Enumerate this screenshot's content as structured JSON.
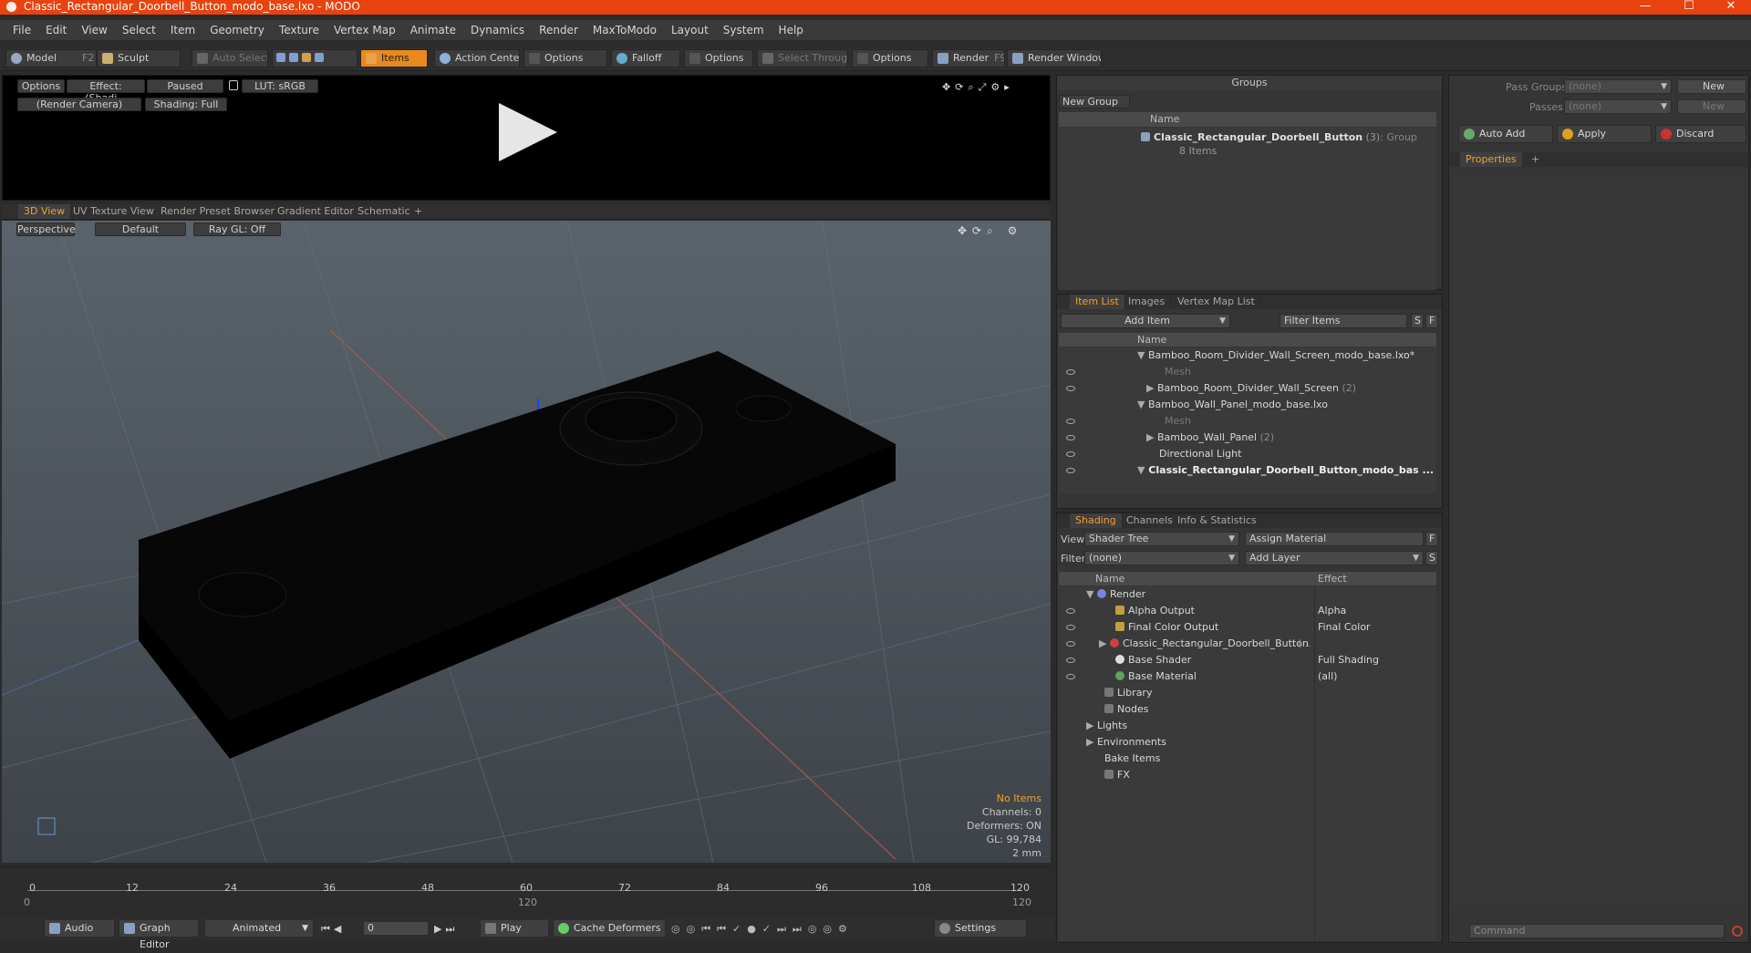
{
  "window": {
    "title": "Classic_Rectangular_Doorbell_Button_modo_base.lxo - MODO",
    "minimize": "—",
    "maximize": "☐",
    "close": "✕"
  },
  "menu": [
    "File",
    "Edit",
    "View",
    "Select",
    "Item",
    "Geometry",
    "Texture",
    "Vertex Map",
    "Animate",
    "Dynamics",
    "Render",
    "MaxToModo",
    "Layout",
    "System",
    "Help"
  ],
  "toolbar": {
    "model": "Model",
    "model_key": "F2",
    "sculpt": "Sculpt",
    "auto_select": "Auto Select",
    "items": "Items",
    "action_center": "Action Center",
    "options1": "Options",
    "falloff": "Falloff",
    "options2": "Options",
    "select_through": "Select Through",
    "options3": "Options",
    "render": "Render",
    "render_key": "F9",
    "render_window": "Render Window"
  },
  "preview": {
    "options": "Options",
    "effect": "Effect: (Shadi...",
    "paused": "Paused",
    "lut": "LUT: sRGB",
    "camera": "(Render Camera)",
    "shading": "Shading: Full"
  },
  "view_tabs": [
    "3D View",
    "UV Texture View",
    "Render Preset Browser",
    "Gradient Editor",
    "Schematic"
  ],
  "viewport": {
    "perspective": "Perspective",
    "default": "Default",
    "raygl": "Ray GL: Off"
  },
  "stats": {
    "no_items": "No Items",
    "channels": "Channels: 0",
    "deformers": "Deformers: ON",
    "gl": "GL: 99,784",
    "unit": "2 mm"
  },
  "timeline": {
    "ticks": [
      "0",
      "12",
      "24",
      "36",
      "48",
      "60",
      "72",
      "84",
      "96",
      "108",
      "120"
    ],
    "lower_start": "0",
    "lower_mid": "120",
    "lower_end": "120"
  },
  "bottom": {
    "audio": "Audio",
    "graph_editor": "Graph Editor",
    "animated": "Animated",
    "frame": "0",
    "play": "Play",
    "cache": "Cache Deformers",
    "settings": "Settings"
  },
  "groups": {
    "title": "Groups",
    "new_group": "New Group",
    "name_col": "Name",
    "item_name": "Classic_Rectangular_Doorbell_Button",
    "item_count": "(3)",
    "item_type": ": Group",
    "item_sub": "8 Items"
  },
  "item_list": {
    "tabs": [
      "Item List",
      "Images",
      "Vertex Map List"
    ],
    "add_item": "Add Item",
    "filter": "Filter Items",
    "s": "S",
    "f": "F",
    "name_col": "Name",
    "rows": [
      {
        "text": "Bamboo_Room_Divider_Wall_Screen_modo_base.lxo*",
        "count": ""
      },
      {
        "text": "Mesh",
        "count": ""
      },
      {
        "text": "Bamboo_Room_Divider_Wall_Screen",
        "count": "(2)"
      },
      {
        "text": "Bamboo_Wall_Panel_modo_base.lxo",
        "count": ""
      },
      {
        "text": "Mesh",
        "count": ""
      },
      {
        "text": "Bamboo_Wall_Panel",
        "count": "(2)"
      },
      {
        "text": "Directional Light",
        "count": ""
      },
      {
        "text": "Classic_Rectangular_Doorbell_Button_modo_bas ...",
        "count": ""
      }
    ]
  },
  "shading": {
    "tabs": [
      "Shading",
      "Channels",
      "Info & Statistics"
    ],
    "view_label": "View",
    "view_value": "Shader Tree",
    "assign": "Assign Material",
    "f": "F",
    "filter_label": "Filter",
    "filter_value": "(none)",
    "add_layer": "Add Layer",
    "s": "S",
    "name_col": "Name",
    "effect_col": "Effect",
    "rows": [
      {
        "name": "Render",
        "effect": ""
      },
      {
        "name": "Alpha Output",
        "effect": "Alpha"
      },
      {
        "name": "Final Color Output",
        "effect": "Final Color"
      },
      {
        "name": "Classic_Rectangular_Doorbell_Button",
        "effect": "(..."
      },
      {
        "name": "Base Shader",
        "effect": "Full Shading"
      },
      {
        "name": "Base Material",
        "effect": "(all)"
      },
      {
        "name": "Library",
        "effect": ""
      },
      {
        "name": "Nodes",
        "effect": ""
      },
      {
        "name": "Lights",
        "effect": ""
      },
      {
        "name": "Environments",
        "effect": ""
      },
      {
        "name": "Bake Items",
        "effect": ""
      },
      {
        "name": "FX",
        "effect": ""
      }
    ]
  },
  "pass": {
    "pass_groups": "Pass Groups",
    "passes": "Passes",
    "none1": "(none)",
    "none2": "(none)",
    "new1": "New",
    "new2": "New",
    "auto_add": "Auto Add",
    "apply": "Apply",
    "discard": "Discard"
  },
  "properties": {
    "tab": "Properties"
  },
  "command": {
    "placeholder": "Command"
  },
  "colors": {
    "accent": "#e8430f",
    "active_tab": "#f0a030",
    "items_button": "#e88a1e"
  }
}
